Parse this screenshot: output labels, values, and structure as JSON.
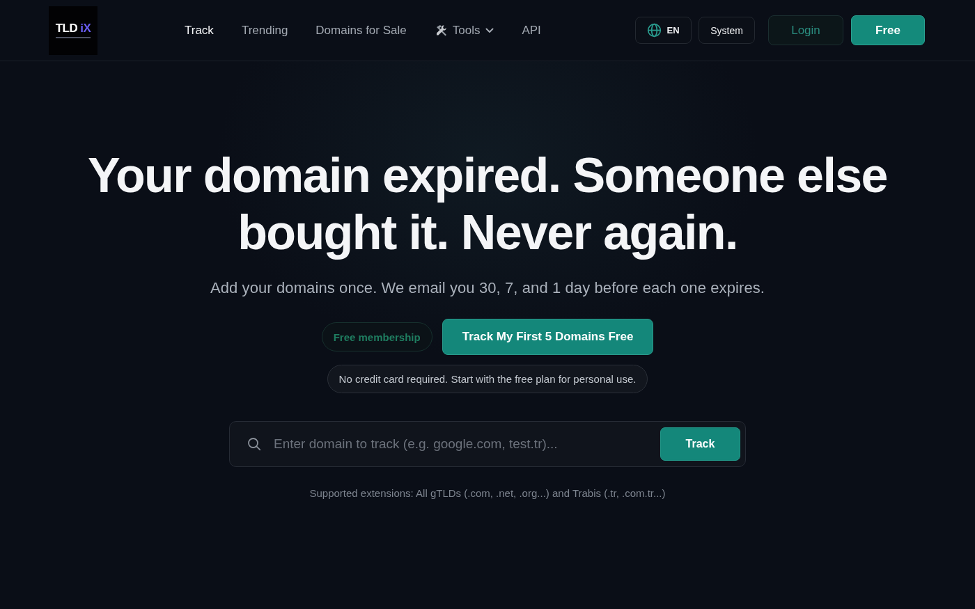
{
  "header": {
    "logo": {
      "text": "TLD",
      "accent": "iX"
    },
    "nav": [
      {
        "label": "Track",
        "selected": true,
        "kind": "link"
      },
      {
        "label": "Trending",
        "selected": false,
        "kind": "link"
      },
      {
        "label": "Domains for Sale",
        "selected": false,
        "kind": "link"
      },
      {
        "label": "Tools",
        "selected": false,
        "kind": "menu"
      },
      {
        "label": "API",
        "selected": false,
        "kind": "link"
      }
    ],
    "language_button": {
      "label": "EN"
    },
    "theme_button": {
      "label": "System"
    },
    "login_button": {
      "label": "Login"
    },
    "signup_button": {
      "label": "Free"
    }
  },
  "hero": {
    "headline": "Your domain expired. Someone else bought it. Never again.",
    "subtitle": "Add your domains once. We email you 30, 7, and 1 day before each one expires.",
    "badge": "Free membership",
    "cta_button": "Track My First 5 Domains Free",
    "note": "No credit card required. Start with the free plan for personal use.",
    "search": {
      "placeholder": "Enter domain to track (e.g. google.com, test.tr)...",
      "button": "Track"
    },
    "supported_extensions": "Supported extensions: All gTLDs (.com, .net, .org...) and Trabis (.tr, .com.tr...)"
  }
}
